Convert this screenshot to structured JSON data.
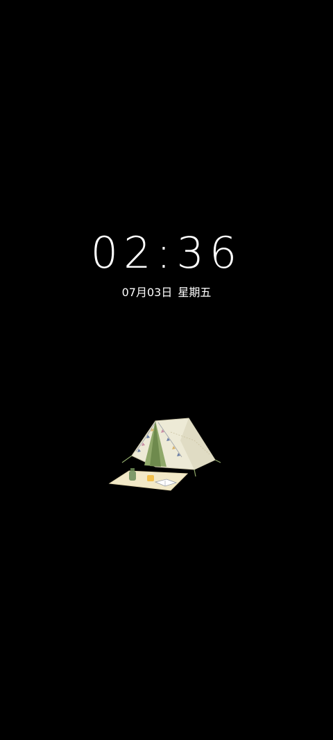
{
  "lockscreen": {
    "time": "02:36",
    "date": "07月03日",
    "weekday": "星期五"
  },
  "illustration": {
    "name": "camping-tent-illustration",
    "colors": {
      "tent": "#EDEAD6",
      "tent_shadow": "#D9D5BC",
      "tent_door": "#8FA86A",
      "mat": "#F2E9C8",
      "cup": "#F2C14E",
      "lantern": "#7E9A6A"
    }
  }
}
